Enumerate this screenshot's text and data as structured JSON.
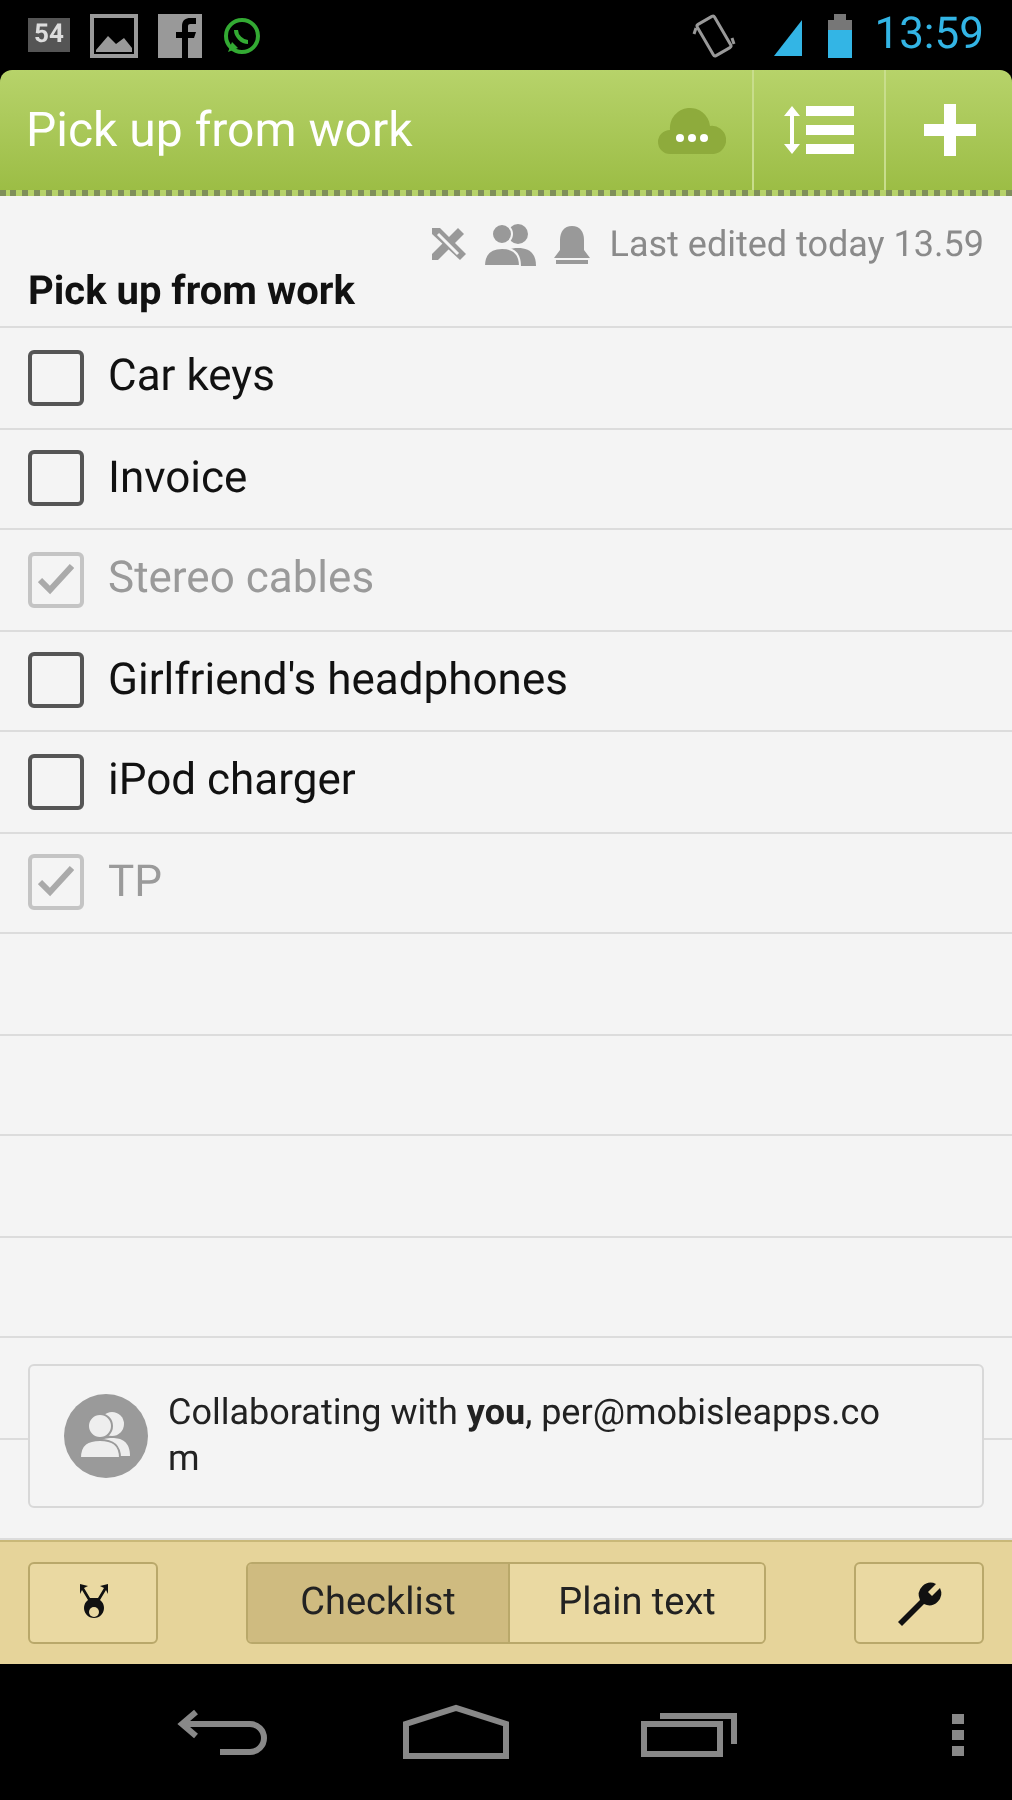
{
  "status_bar": {
    "notification_count": "54",
    "time": "13:59"
  },
  "toolbar": {
    "title": "Pick up from work"
  },
  "note": {
    "meta": "Last edited today 13.59",
    "title": "Pick up from work",
    "items": [
      {
        "text": "Car keys",
        "checked": false
      },
      {
        "text": "Invoice",
        "checked": false
      },
      {
        "text": "Stereo cables",
        "checked": true
      },
      {
        "text": "Girlfriend's headphones",
        "checked": false
      },
      {
        "text": "iPod charger",
        "checked": false
      },
      {
        "text": "TP",
        "checked": true
      }
    ]
  },
  "collaboration": {
    "text": "Collaborating with **you**, per@mobisleapps.com"
  },
  "bottom_bar": {
    "modes": [
      {
        "label": "Checklist",
        "selected": true
      },
      {
        "label": "Plain text",
        "selected": false
      }
    ]
  }
}
